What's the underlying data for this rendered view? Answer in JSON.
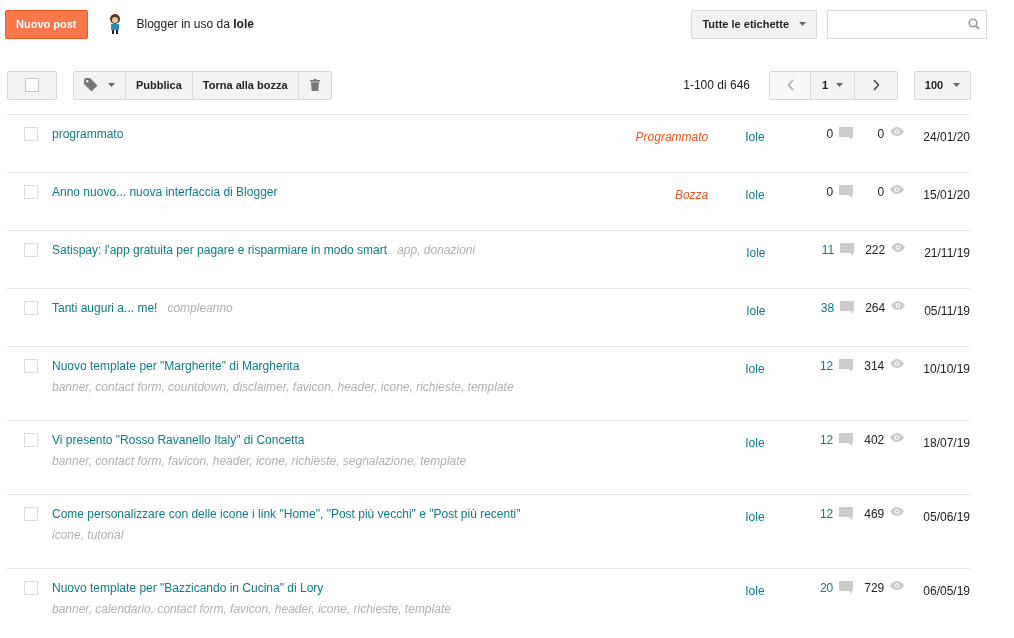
{
  "header": {
    "new_post": "Nuovo post",
    "user_text": "Blogger in uso da **Iole**",
    "labels_filter": "Tutte le etichette"
  },
  "toolbar": {
    "select_all": {
      "checked": false
    },
    "publish": "Pubblica",
    "revert": "Torna alla bozza",
    "range": "1-100 di 646",
    "page": "1",
    "per_page": "100"
  },
  "posts": [
    {
      "title": "programmato",
      "status": "Programmato",
      "author": "Iole",
      "comments": "0",
      "comments_linked": false,
      "views": "0",
      "date": "24/01/20",
      "checked": false
    },
    {
      "title": "Anno nuovo... nuova interfaccia di Blogger",
      "status": "Bozza",
      "author": "Iole",
      "comments": "0",
      "comments_linked": false,
      "views": "0",
      "date": "15/01/20",
      "checked": false
    },
    {
      "title": "Satispay: l'app gratuita per pagare e risparmiare in modo smart",
      "labels": "app, donazioni",
      "labels_inline": true,
      "author": "Iole",
      "comments": "11",
      "comments_linked": true,
      "views": "222",
      "date": "21/11/19",
      "checked": false
    },
    {
      "title": "Tanti auguri a... me!",
      "labels": "compleanno",
      "labels_inline": true,
      "author": "Iole",
      "comments": "38",
      "comments_linked": true,
      "views": "264",
      "date": "05/11/19",
      "checked": false
    },
    {
      "title": "Nuovo template per \"Margherite\" di Margherita",
      "labels": "banner, contact form, countdown, disclaimer, favicon, header, icone, richieste, template",
      "labels_inline": false,
      "author": "Iole",
      "comments": "12",
      "comments_linked": true,
      "views": "314",
      "date": "10/10/19",
      "checked": false
    },
    {
      "title": "Vi presento \"Rosso Ravanello Italy\" di Concetta",
      "labels": "banner, contact form, favicon, header, icone, richieste, segnalazione, template",
      "labels_inline": false,
      "author": "Iole",
      "comments": "12",
      "comments_linked": true,
      "views": "402",
      "date": "18/07/19",
      "checked": false
    },
    {
      "title": "Come personalizzare con delle icone i link \"Home\", \"Post più vecchi\" e \"Post più recenti\"",
      "labels": "icone, tutorial",
      "labels_inline": false,
      "author": "Iole",
      "comments": "12",
      "comments_linked": true,
      "views": "469",
      "date": "05/06/19",
      "checked": false
    },
    {
      "title": "Nuovo template per \"Bazzicando in Cucina\" di Lory",
      "labels": "banner, calendario, contact form, favicon, header, icone, richieste, template",
      "labels_inline": false,
      "author": "Iole",
      "comments": "20",
      "comments_linked": true,
      "views": "729",
      "date": "06/05/19",
      "checked": false
    }
  ]
}
